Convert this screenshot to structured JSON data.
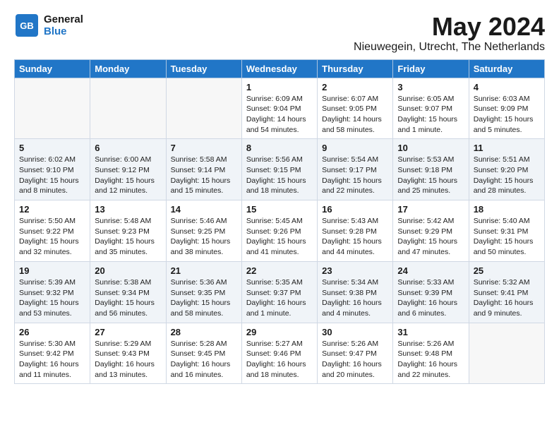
{
  "logo": {
    "line1": "General",
    "line2": "Blue"
  },
  "title": "May 2024",
  "subtitle": "Nieuwegein, Utrecht, The Netherlands",
  "days_of_week": [
    "Sunday",
    "Monday",
    "Tuesday",
    "Wednesday",
    "Thursday",
    "Friday",
    "Saturday"
  ],
  "weeks": [
    [
      {
        "day": "",
        "info": ""
      },
      {
        "day": "",
        "info": ""
      },
      {
        "day": "",
        "info": ""
      },
      {
        "day": "1",
        "info": "Sunrise: 6:09 AM\nSunset: 9:04 PM\nDaylight: 14 hours\nand 54 minutes."
      },
      {
        "day": "2",
        "info": "Sunrise: 6:07 AM\nSunset: 9:05 PM\nDaylight: 14 hours\nand 58 minutes."
      },
      {
        "day": "3",
        "info": "Sunrise: 6:05 AM\nSunset: 9:07 PM\nDaylight: 15 hours\nand 1 minute."
      },
      {
        "day": "4",
        "info": "Sunrise: 6:03 AM\nSunset: 9:09 PM\nDaylight: 15 hours\nand 5 minutes."
      }
    ],
    [
      {
        "day": "5",
        "info": "Sunrise: 6:02 AM\nSunset: 9:10 PM\nDaylight: 15 hours\nand 8 minutes."
      },
      {
        "day": "6",
        "info": "Sunrise: 6:00 AM\nSunset: 9:12 PM\nDaylight: 15 hours\nand 12 minutes."
      },
      {
        "day": "7",
        "info": "Sunrise: 5:58 AM\nSunset: 9:14 PM\nDaylight: 15 hours\nand 15 minutes."
      },
      {
        "day": "8",
        "info": "Sunrise: 5:56 AM\nSunset: 9:15 PM\nDaylight: 15 hours\nand 18 minutes."
      },
      {
        "day": "9",
        "info": "Sunrise: 5:54 AM\nSunset: 9:17 PM\nDaylight: 15 hours\nand 22 minutes."
      },
      {
        "day": "10",
        "info": "Sunrise: 5:53 AM\nSunset: 9:18 PM\nDaylight: 15 hours\nand 25 minutes."
      },
      {
        "day": "11",
        "info": "Sunrise: 5:51 AM\nSunset: 9:20 PM\nDaylight: 15 hours\nand 28 minutes."
      }
    ],
    [
      {
        "day": "12",
        "info": "Sunrise: 5:50 AM\nSunset: 9:22 PM\nDaylight: 15 hours\nand 32 minutes."
      },
      {
        "day": "13",
        "info": "Sunrise: 5:48 AM\nSunset: 9:23 PM\nDaylight: 15 hours\nand 35 minutes."
      },
      {
        "day": "14",
        "info": "Sunrise: 5:46 AM\nSunset: 9:25 PM\nDaylight: 15 hours\nand 38 minutes."
      },
      {
        "day": "15",
        "info": "Sunrise: 5:45 AM\nSunset: 9:26 PM\nDaylight: 15 hours\nand 41 minutes."
      },
      {
        "day": "16",
        "info": "Sunrise: 5:43 AM\nSunset: 9:28 PM\nDaylight: 15 hours\nand 44 minutes."
      },
      {
        "day": "17",
        "info": "Sunrise: 5:42 AM\nSunset: 9:29 PM\nDaylight: 15 hours\nand 47 minutes."
      },
      {
        "day": "18",
        "info": "Sunrise: 5:40 AM\nSunset: 9:31 PM\nDaylight: 15 hours\nand 50 minutes."
      }
    ],
    [
      {
        "day": "19",
        "info": "Sunrise: 5:39 AM\nSunset: 9:32 PM\nDaylight: 15 hours\nand 53 minutes."
      },
      {
        "day": "20",
        "info": "Sunrise: 5:38 AM\nSunset: 9:34 PM\nDaylight: 15 hours\nand 56 minutes."
      },
      {
        "day": "21",
        "info": "Sunrise: 5:36 AM\nSunset: 9:35 PM\nDaylight: 15 hours\nand 58 minutes."
      },
      {
        "day": "22",
        "info": "Sunrise: 5:35 AM\nSunset: 9:37 PM\nDaylight: 16 hours\nand 1 minute."
      },
      {
        "day": "23",
        "info": "Sunrise: 5:34 AM\nSunset: 9:38 PM\nDaylight: 16 hours\nand 4 minutes."
      },
      {
        "day": "24",
        "info": "Sunrise: 5:33 AM\nSunset: 9:39 PM\nDaylight: 16 hours\nand 6 minutes."
      },
      {
        "day": "25",
        "info": "Sunrise: 5:32 AM\nSunset: 9:41 PM\nDaylight: 16 hours\nand 9 minutes."
      }
    ],
    [
      {
        "day": "26",
        "info": "Sunrise: 5:30 AM\nSunset: 9:42 PM\nDaylight: 16 hours\nand 11 minutes."
      },
      {
        "day": "27",
        "info": "Sunrise: 5:29 AM\nSunset: 9:43 PM\nDaylight: 16 hours\nand 13 minutes."
      },
      {
        "day": "28",
        "info": "Sunrise: 5:28 AM\nSunset: 9:45 PM\nDaylight: 16 hours\nand 16 minutes."
      },
      {
        "day": "29",
        "info": "Sunrise: 5:27 AM\nSunset: 9:46 PM\nDaylight: 16 hours\nand 18 minutes."
      },
      {
        "day": "30",
        "info": "Sunrise: 5:26 AM\nSunset: 9:47 PM\nDaylight: 16 hours\nand 20 minutes."
      },
      {
        "day": "31",
        "info": "Sunrise: 5:26 AM\nSunset: 9:48 PM\nDaylight: 16 hours\nand 22 minutes."
      },
      {
        "day": "",
        "info": ""
      }
    ]
  ]
}
